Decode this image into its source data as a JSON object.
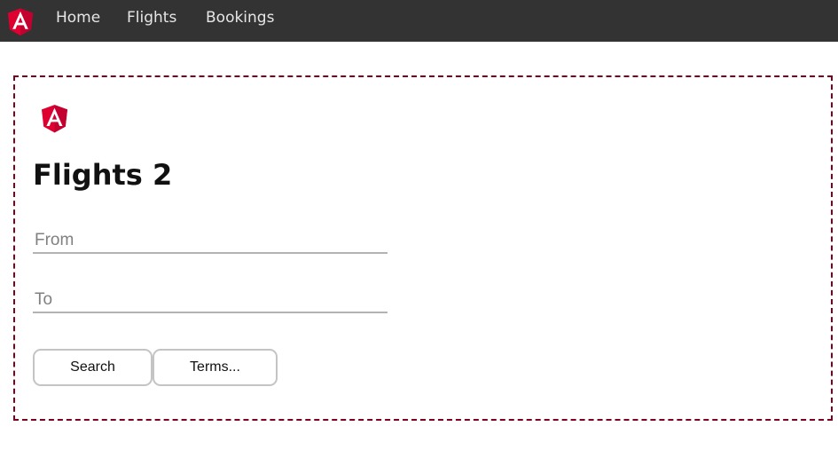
{
  "nav": {
    "logo_icon": "angular-logo-icon",
    "links": [
      "Home",
      "Flights",
      "Bookings"
    ]
  },
  "page": {
    "logo_icon": "angular-logo-icon",
    "title": "Flights 2"
  },
  "form": {
    "from_placeholder": "From",
    "from_value": "",
    "to_placeholder": "To",
    "to_value": ""
  },
  "buttons": {
    "search_label": "Search",
    "terms_label": "Terms..."
  },
  "colors": {
    "navbar_bg": "#333333",
    "nav_text": "#e6e6e6",
    "card_border": "#800020",
    "angular_red": "#dd0031",
    "angular_dark_red": "#c3002f"
  }
}
